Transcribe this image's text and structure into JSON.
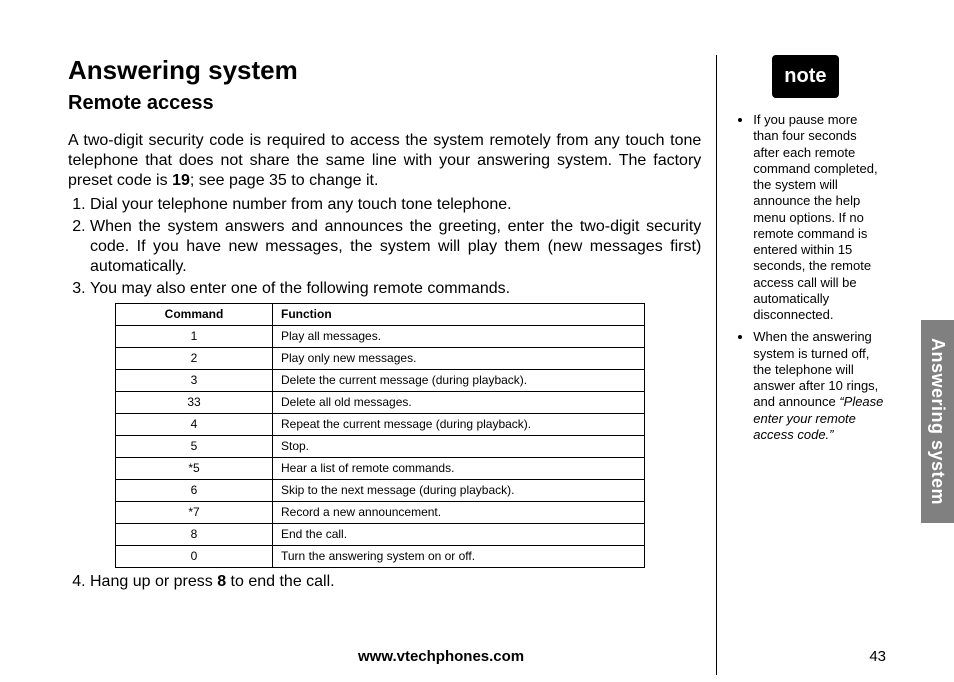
{
  "page": {
    "title": "Answering system",
    "section": "Remote access",
    "intro_pre": "A two-digit security code is required to access the system remotely from any touch tone telephone that does not share the same line with your answering system. The factory preset code is ",
    "intro_bold": "19",
    "intro_post": "; see page 35 to change it.",
    "steps": {
      "s1": "Dial your telephone number from any touch tone telephone.",
      "s2": "When the system answers and announces the greeting, enter the two-digit security code. If you have new messages, the system will play them (new messages first) automatically.",
      "s3": "You may also enter one of the following remote commands.",
      "s4_pre": "Hang up or press ",
      "s4_bold": "8",
      "s4_post": " to end the call."
    },
    "table": {
      "header_cmd": "Command",
      "header_func": "Function",
      "rows": [
        {
          "cmd": "1",
          "func": "Play all messages."
        },
        {
          "cmd": "2",
          "func": "Play only new messages."
        },
        {
          "cmd": "3",
          "func": "Delete the current message (during playback)."
        },
        {
          "cmd": "33",
          "func": "Delete all old messages."
        },
        {
          "cmd": "4",
          "func": "Repeat the current message (during playback)."
        },
        {
          "cmd": "5",
          "func": "Stop."
        },
        {
          "cmd": "*5",
          "func": "Hear a list of remote commands."
        },
        {
          "cmd": "6",
          "func": "Skip to the next message (during playback)."
        },
        {
          "cmd": "*7",
          "func": "Record a new announcement."
        },
        {
          "cmd": "8",
          "func": "End the call."
        },
        {
          "cmd": "0",
          "func": "Turn the answering system on or off."
        }
      ]
    },
    "footer_url": "www.vtechphones.com",
    "footer_page": "43",
    "side_tab": "Answering system"
  },
  "note": {
    "badge": "note",
    "items": {
      "n1": "If you pause more than four seconds after each remote command completed, the system will announce the help menu options. If no remote command is entered within 15 seconds, the remote access call will be automatically disconnected.",
      "n2_pre": "When the answering system is turned off, the telephone will answer after 10 rings, and announce ",
      "n2_italic": "“Please enter your remote access code.”"
    }
  }
}
